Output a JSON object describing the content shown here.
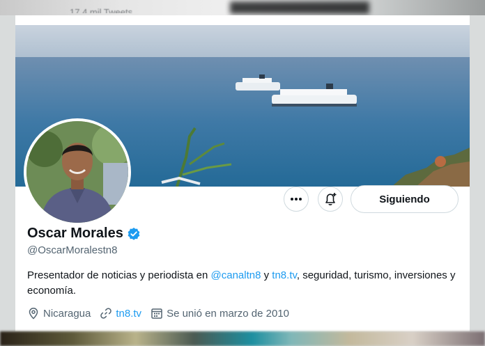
{
  "header": {
    "tweets_count": "17,4 mil Tweets"
  },
  "profile": {
    "name": "Oscar Morales",
    "handle": "@OscarMoralestn8",
    "bio": {
      "part1": "Presentador de noticias y periodista en ",
      "mention": "@canaltn8",
      "part2": " y ",
      "link": "tn8.tv",
      "part3": ", seguridad, turismo, inversiones y economía."
    },
    "location": "Nicaragua",
    "website": "tn8.tv",
    "joined": "Se unió en marzo de 2010",
    "verified": true
  },
  "actions": {
    "follow_label": "Siguiendo"
  },
  "icons": {
    "more": "more-icon",
    "bell": "bell-plus-icon",
    "location": "location-pin-icon",
    "link": "link-icon",
    "calendar": "calendar-icon",
    "verified": "verified-badge-icon"
  },
  "colors": {
    "link": "#1d9bf0",
    "verified": "#1d9bf0",
    "secondary_text": "#536471"
  }
}
